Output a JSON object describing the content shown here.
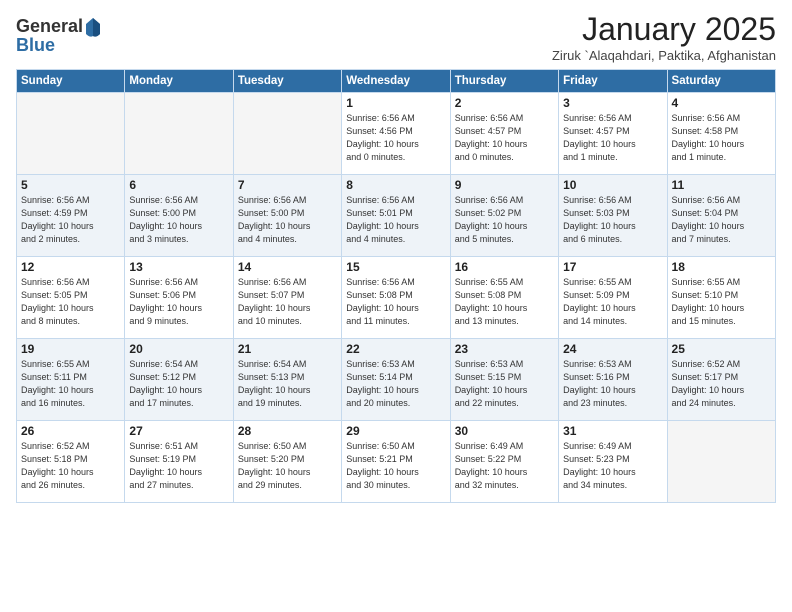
{
  "header": {
    "logo_general": "General",
    "logo_blue": "Blue",
    "month_title": "January 2025",
    "location": "Ziruk `Alaqahdari, Paktika, Afghanistan"
  },
  "weekdays": [
    "Sunday",
    "Monday",
    "Tuesday",
    "Wednesday",
    "Thursday",
    "Friday",
    "Saturday"
  ],
  "weeks": [
    {
      "shaded": false,
      "days": [
        {
          "num": "",
          "info": ""
        },
        {
          "num": "",
          "info": ""
        },
        {
          "num": "",
          "info": ""
        },
        {
          "num": "1",
          "info": "Sunrise: 6:56 AM\nSunset: 4:56 PM\nDaylight: 10 hours\nand 0 minutes."
        },
        {
          "num": "2",
          "info": "Sunrise: 6:56 AM\nSunset: 4:57 PM\nDaylight: 10 hours\nand 0 minutes."
        },
        {
          "num": "3",
          "info": "Sunrise: 6:56 AM\nSunset: 4:57 PM\nDaylight: 10 hours\nand 1 minute."
        },
        {
          "num": "4",
          "info": "Sunrise: 6:56 AM\nSunset: 4:58 PM\nDaylight: 10 hours\nand 1 minute."
        }
      ]
    },
    {
      "shaded": true,
      "days": [
        {
          "num": "5",
          "info": "Sunrise: 6:56 AM\nSunset: 4:59 PM\nDaylight: 10 hours\nand 2 minutes."
        },
        {
          "num": "6",
          "info": "Sunrise: 6:56 AM\nSunset: 5:00 PM\nDaylight: 10 hours\nand 3 minutes."
        },
        {
          "num": "7",
          "info": "Sunrise: 6:56 AM\nSunset: 5:00 PM\nDaylight: 10 hours\nand 4 minutes."
        },
        {
          "num": "8",
          "info": "Sunrise: 6:56 AM\nSunset: 5:01 PM\nDaylight: 10 hours\nand 4 minutes."
        },
        {
          "num": "9",
          "info": "Sunrise: 6:56 AM\nSunset: 5:02 PM\nDaylight: 10 hours\nand 5 minutes."
        },
        {
          "num": "10",
          "info": "Sunrise: 6:56 AM\nSunset: 5:03 PM\nDaylight: 10 hours\nand 6 minutes."
        },
        {
          "num": "11",
          "info": "Sunrise: 6:56 AM\nSunset: 5:04 PM\nDaylight: 10 hours\nand 7 minutes."
        }
      ]
    },
    {
      "shaded": false,
      "days": [
        {
          "num": "12",
          "info": "Sunrise: 6:56 AM\nSunset: 5:05 PM\nDaylight: 10 hours\nand 8 minutes."
        },
        {
          "num": "13",
          "info": "Sunrise: 6:56 AM\nSunset: 5:06 PM\nDaylight: 10 hours\nand 9 minutes."
        },
        {
          "num": "14",
          "info": "Sunrise: 6:56 AM\nSunset: 5:07 PM\nDaylight: 10 hours\nand 10 minutes."
        },
        {
          "num": "15",
          "info": "Sunrise: 6:56 AM\nSunset: 5:08 PM\nDaylight: 10 hours\nand 11 minutes."
        },
        {
          "num": "16",
          "info": "Sunrise: 6:55 AM\nSunset: 5:08 PM\nDaylight: 10 hours\nand 13 minutes."
        },
        {
          "num": "17",
          "info": "Sunrise: 6:55 AM\nSunset: 5:09 PM\nDaylight: 10 hours\nand 14 minutes."
        },
        {
          "num": "18",
          "info": "Sunrise: 6:55 AM\nSunset: 5:10 PM\nDaylight: 10 hours\nand 15 minutes."
        }
      ]
    },
    {
      "shaded": true,
      "days": [
        {
          "num": "19",
          "info": "Sunrise: 6:55 AM\nSunset: 5:11 PM\nDaylight: 10 hours\nand 16 minutes."
        },
        {
          "num": "20",
          "info": "Sunrise: 6:54 AM\nSunset: 5:12 PM\nDaylight: 10 hours\nand 17 minutes."
        },
        {
          "num": "21",
          "info": "Sunrise: 6:54 AM\nSunset: 5:13 PM\nDaylight: 10 hours\nand 19 minutes."
        },
        {
          "num": "22",
          "info": "Sunrise: 6:53 AM\nSunset: 5:14 PM\nDaylight: 10 hours\nand 20 minutes."
        },
        {
          "num": "23",
          "info": "Sunrise: 6:53 AM\nSunset: 5:15 PM\nDaylight: 10 hours\nand 22 minutes."
        },
        {
          "num": "24",
          "info": "Sunrise: 6:53 AM\nSunset: 5:16 PM\nDaylight: 10 hours\nand 23 minutes."
        },
        {
          "num": "25",
          "info": "Sunrise: 6:52 AM\nSunset: 5:17 PM\nDaylight: 10 hours\nand 24 minutes."
        }
      ]
    },
    {
      "shaded": false,
      "days": [
        {
          "num": "26",
          "info": "Sunrise: 6:52 AM\nSunset: 5:18 PM\nDaylight: 10 hours\nand 26 minutes."
        },
        {
          "num": "27",
          "info": "Sunrise: 6:51 AM\nSunset: 5:19 PM\nDaylight: 10 hours\nand 27 minutes."
        },
        {
          "num": "28",
          "info": "Sunrise: 6:50 AM\nSunset: 5:20 PM\nDaylight: 10 hours\nand 29 minutes."
        },
        {
          "num": "29",
          "info": "Sunrise: 6:50 AM\nSunset: 5:21 PM\nDaylight: 10 hours\nand 30 minutes."
        },
        {
          "num": "30",
          "info": "Sunrise: 6:49 AM\nSunset: 5:22 PM\nDaylight: 10 hours\nand 32 minutes."
        },
        {
          "num": "31",
          "info": "Sunrise: 6:49 AM\nSunset: 5:23 PM\nDaylight: 10 hours\nand 34 minutes."
        },
        {
          "num": "",
          "info": ""
        }
      ]
    }
  ]
}
